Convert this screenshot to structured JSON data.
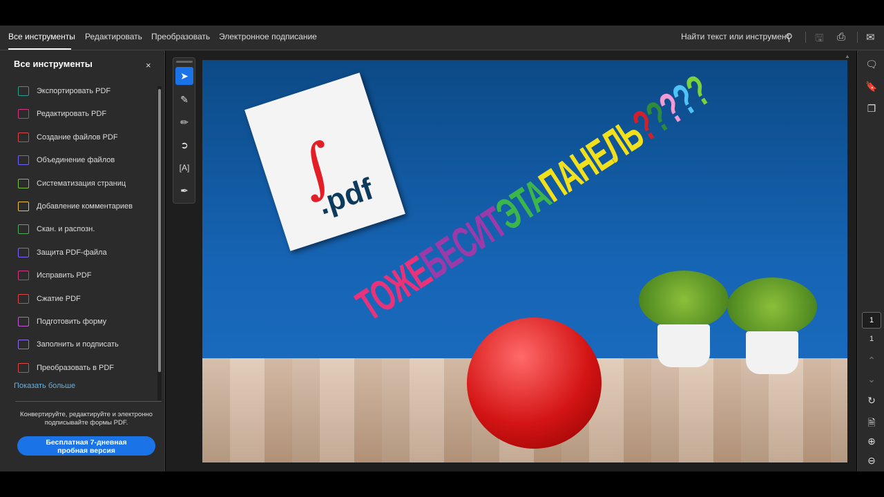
{
  "toolbar": {
    "tabs": [
      "Все инструменты",
      "Редактировать",
      "Преобразовать",
      "Электронное подписание"
    ],
    "search_label": "Найти текст или инструмент"
  },
  "sidebar": {
    "title": "Все инструменты",
    "close": "×",
    "items": [
      {
        "label": "Экспортировать PDF",
        "color": "#2a9d8f"
      },
      {
        "label": "Редактировать PDF",
        "color": "#d63384"
      },
      {
        "label": "Создание файлов PDF",
        "color": "#e04646"
      },
      {
        "label": "Объединение файлов",
        "color": "#6c63ff"
      },
      {
        "label": "Систематизация страниц",
        "color": "#7cc242"
      },
      {
        "label": "Добавление комментариев",
        "color": "#f2c12e"
      },
      {
        "label": "Скан. и распозн.",
        "color": "#4cb05a"
      },
      {
        "label": "Защита PDF-файла",
        "color": "#7b61ff"
      },
      {
        "label": "Исправить PDF",
        "color": "#d63384"
      },
      {
        "label": "Сжатие PDF",
        "color": "#e04646"
      },
      {
        "label": "Подготовить форму",
        "color": "#c45ad6"
      },
      {
        "label": "Заполнить и подписать",
        "color": "#8f6cf0"
      },
      {
        "label": "Преобразовать в PDF",
        "color": "#e04646"
      }
    ],
    "show_more": "Показать больше",
    "promo_text": "Конвертируйте, редактируйте и электронно подписывайте формы PDF.",
    "trial_button_line1": "Бесплатная 7-дневная",
    "trial_button_line2": "пробная версия"
  },
  "document": {
    "pdf_ext": ".pdf",
    "meme_words": [
      {
        "text": "ТОЖЕ ",
        "color": "#e8327a"
      },
      {
        "text": "БЕСИТ ",
        "color": "#9b3aa8"
      },
      {
        "text": "ЭТА ",
        "color": "#3cb54a"
      },
      {
        "text": "ПАНЕЛЬ",
        "color": "#f3e01c"
      },
      {
        "text": "?",
        "color": "#d0202a"
      },
      {
        "text": "?",
        "color": "#2e8b3a"
      },
      {
        "text": "?",
        "color": "#f19ad6"
      },
      {
        "text": "?",
        "color": "#4fc3f7"
      },
      {
        "text": "?",
        "color": "#7cd23a"
      }
    ]
  },
  "pagination": {
    "current": "1",
    "total": "1"
  },
  "accent": "#1b73e8"
}
